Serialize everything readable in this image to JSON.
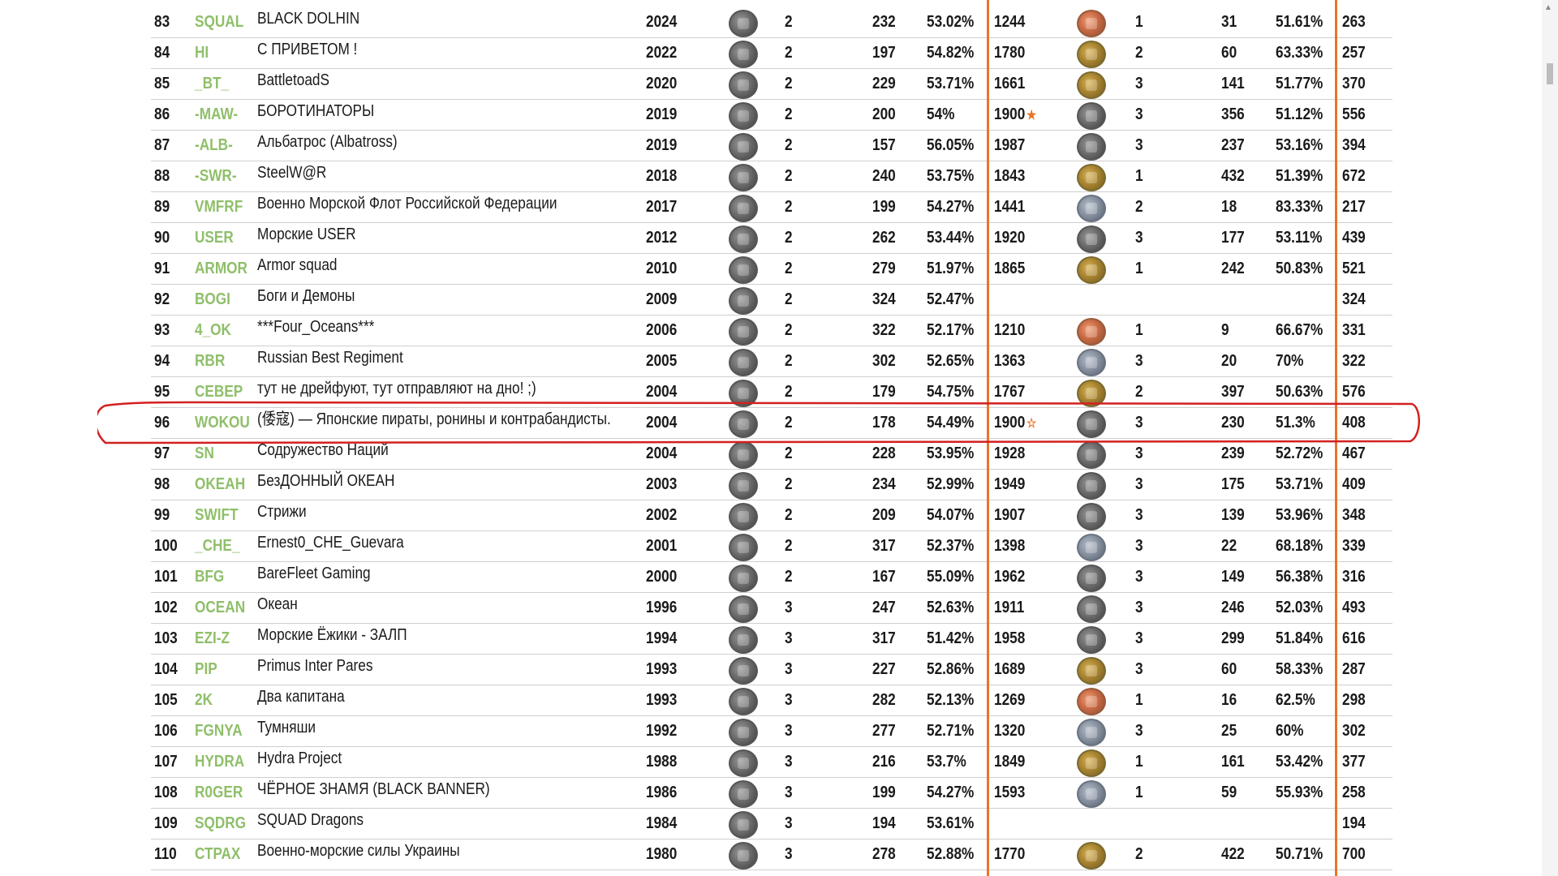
{
  "table": {
    "rows": [
      {
        "rank": "83",
        "tag": "SQUAL",
        "name": "BLACK DOLHIN",
        "year": "2024",
        "m1": "steel",
        "tier": "2",
        "battles": "232",
        "win": "53.02%",
        "rating": "1244",
        "star": "",
        "m2": "bronze",
        "t2": "1",
        "b2": "31",
        "w2": "51.61%",
        "total": "263"
      },
      {
        "rank": "84",
        "tag": "HI",
        "name": "С ПРИВЕТОМ !",
        "year": "2022",
        "m1": "steel",
        "tier": "2",
        "battles": "197",
        "win": "54.82%",
        "rating": "1780",
        "star": "",
        "m2": "gold",
        "t2": "2",
        "b2": "60",
        "w2": "63.33%",
        "total": "257"
      },
      {
        "rank": "85",
        "tag": "_BT_",
        "name": "BattletoadS",
        "year": "2020",
        "m1": "steel",
        "tier": "2",
        "battles": "229",
        "win": "53.71%",
        "rating": "1661",
        "star": "",
        "m2": "gold",
        "t2": "3",
        "b2": "141",
        "w2": "51.77%",
        "total": "370"
      },
      {
        "rank": "86",
        "tag": "-MAW-",
        "name": "БОРОТИНАТОРЫ",
        "year": "2019",
        "m1": "steel",
        "tier": "2",
        "battles": "200",
        "win": "54%",
        "rating": "1900",
        "star": "★",
        "m2": "steel",
        "t2": "3",
        "b2": "356",
        "w2": "51.12%",
        "total": "556"
      },
      {
        "rank": "87",
        "tag": "-ALB-",
        "name": "Альбатрос (Albatross)",
        "year": "2019",
        "m1": "steel",
        "tier": "2",
        "battles": "157",
        "win": "56.05%",
        "rating": "1987",
        "star": "",
        "m2": "steel",
        "t2": "3",
        "b2": "237",
        "w2": "53.16%",
        "total": "394"
      },
      {
        "rank": "88",
        "tag": "-SWR-",
        "name": "SteelW@R",
        "year": "2018",
        "m1": "steel",
        "tier": "2",
        "battles": "240",
        "win": "53.75%",
        "rating": "1843",
        "star": "",
        "m2": "gold",
        "t2": "1",
        "b2": "432",
        "w2": "51.39%",
        "total": "672"
      },
      {
        "rank": "89",
        "tag": "VMFRF",
        "name": "Военно Морской Флот Российской Федерации",
        "year": "2017",
        "m1": "steel",
        "tier": "2",
        "battles": "199",
        "win": "54.27%",
        "rating": "1441",
        "star": "",
        "m2": "silver",
        "t2": "2",
        "b2": "18",
        "w2": "83.33%",
        "total": "217"
      },
      {
        "rank": "90",
        "tag": "USER",
        "name": "Морские USER",
        "year": "2012",
        "m1": "steel",
        "tier": "2",
        "battles": "262",
        "win": "53.44%",
        "rating": "1920",
        "star": "",
        "m2": "steel",
        "t2": "3",
        "b2": "177",
        "w2": "53.11%",
        "total": "439"
      },
      {
        "rank": "91",
        "tag": "ARMOR",
        "name": "Armor squad",
        "year": "2010",
        "m1": "steel",
        "tier": "2",
        "battles": "279",
        "win": "51.97%",
        "rating": "1865",
        "star": "",
        "m2": "gold",
        "t2": "1",
        "b2": "242",
        "w2": "50.83%",
        "total": "521"
      },
      {
        "rank": "92",
        "tag": "BOGI",
        "name": "Боги и Демоны",
        "year": "2009",
        "m1": "steel",
        "tier": "2",
        "battles": "324",
        "win": "52.47%",
        "rating": "",
        "star": "",
        "m2": "",
        "t2": "",
        "b2": "",
        "w2": "",
        "total": "324"
      },
      {
        "rank": "93",
        "tag": "4_OK",
        "name": "***Four_Oceans***",
        "year": "2006",
        "m1": "steel",
        "tier": "2",
        "battles": "322",
        "win": "52.17%",
        "rating": "1210",
        "star": "",
        "m2": "bronze",
        "t2": "1",
        "b2": "9",
        "w2": "66.67%",
        "total": "331"
      },
      {
        "rank": "94",
        "tag": "RBR",
        "name": "Russian Best Regiment",
        "year": "2005",
        "m1": "steel",
        "tier": "2",
        "battles": "302",
        "win": "52.65%",
        "rating": "1363",
        "star": "",
        "m2": "silver",
        "t2": "3",
        "b2": "20",
        "w2": "70%",
        "total": "322"
      },
      {
        "rank": "95",
        "tag": "СЕВЕР",
        "name": "тут не дрейфуют, тут отправляют на дно! ;)",
        "year": "2004",
        "m1": "steel",
        "tier": "2",
        "battles": "179",
        "win": "54.75%",
        "rating": "1767",
        "star": "",
        "m2": "gold",
        "t2": "2",
        "b2": "397",
        "w2": "50.63%",
        "total": "576"
      },
      {
        "rank": "96",
        "tag": "WOKOU",
        "name": "(倭寇) — Японские пираты, ронины и контрабандисты.",
        "year": "2004",
        "m1": "steel",
        "tier": "2",
        "battles": "178",
        "win": "54.49%",
        "rating": "1900",
        "star": "☆",
        "m2": "steel",
        "t2": "3",
        "b2": "230",
        "w2": "51.3%",
        "total": "408"
      },
      {
        "rank": "97",
        "tag": "SN",
        "name": "Содружество Наций",
        "year": "2004",
        "m1": "steel",
        "tier": "2",
        "battles": "228",
        "win": "53.95%",
        "rating": "1928",
        "star": "",
        "m2": "steel",
        "t2": "3",
        "b2": "239",
        "w2": "52.72%",
        "total": "467"
      },
      {
        "rank": "98",
        "tag": "OKEAH",
        "name": "БезДОННЫЙ ОКЕАН",
        "year": "2003",
        "m1": "steel",
        "tier": "2",
        "battles": "234",
        "win": "52.99%",
        "rating": "1949",
        "star": "",
        "m2": "steel",
        "t2": "3",
        "b2": "175",
        "w2": "53.71%",
        "total": "409"
      },
      {
        "rank": "99",
        "tag": "SWIFT",
        "name": "Стрижи",
        "year": "2002",
        "m1": "steel",
        "tier": "2",
        "battles": "209",
        "win": "54.07%",
        "rating": "1907",
        "star": "",
        "m2": "steel",
        "t2": "3",
        "b2": "139",
        "w2": "53.96%",
        "total": "348"
      },
      {
        "rank": "100",
        "tag": "_CHE_",
        "name": "Ernest0_CHE_Guevara",
        "year": "2001",
        "m1": "steel",
        "tier": "2",
        "battles": "317",
        "win": "52.37%",
        "rating": "1398",
        "star": "",
        "m2": "silver",
        "t2": "3",
        "b2": "22",
        "w2": "68.18%",
        "total": "339"
      },
      {
        "rank": "101",
        "tag": "BFG",
        "name": "BareFleet Gaming",
        "year": "2000",
        "m1": "steel",
        "tier": "2",
        "battles": "167",
        "win": "55.09%",
        "rating": "1962",
        "star": "",
        "m2": "steel",
        "t2": "3",
        "b2": "149",
        "w2": "56.38%",
        "total": "316"
      },
      {
        "rank": "102",
        "tag": "OCEAN",
        "name": "Океан",
        "year": "1996",
        "m1": "steel",
        "tier": "3",
        "battles": "247",
        "win": "52.63%",
        "rating": "1911",
        "star": "",
        "m2": "steel",
        "t2": "3",
        "b2": "246",
        "w2": "52.03%",
        "total": "493"
      },
      {
        "rank": "103",
        "tag": "EZI-Z",
        "name": "Морские Ёжики - ЗАЛП",
        "year": "1994",
        "m1": "steel",
        "tier": "3",
        "battles": "317",
        "win": "51.42%",
        "rating": "1958",
        "star": "",
        "m2": "steel",
        "t2": "3",
        "b2": "299",
        "w2": "51.84%",
        "total": "616"
      },
      {
        "rank": "104",
        "tag": "PIP",
        "name": "Primus Inter Pares",
        "year": "1993",
        "m1": "steel",
        "tier": "3",
        "battles": "227",
        "win": "52.86%",
        "rating": "1689",
        "star": "",
        "m2": "gold",
        "t2": "3",
        "b2": "60",
        "w2": "58.33%",
        "total": "287"
      },
      {
        "rank": "105",
        "tag": "2K",
        "name": "Два капитана",
        "year": "1993",
        "m1": "steel",
        "tier": "3",
        "battles": "282",
        "win": "52.13%",
        "rating": "1269",
        "star": "",
        "m2": "bronze",
        "t2": "1",
        "b2": "16",
        "w2": "62.5%",
        "total": "298"
      },
      {
        "rank": "106",
        "tag": "FGNYA",
        "name": "Тумняши",
        "year": "1992",
        "m1": "steel",
        "tier": "3",
        "battles": "277",
        "win": "52.71%",
        "rating": "1320",
        "star": "",
        "m2": "silver",
        "t2": "3",
        "b2": "25",
        "w2": "60%",
        "total": "302"
      },
      {
        "rank": "107",
        "tag": "HYDRA",
        "name": "Hydra Project",
        "year": "1988",
        "m1": "steel",
        "tier": "3",
        "battles": "216",
        "win": "53.7%",
        "rating": "1849",
        "star": "",
        "m2": "gold",
        "t2": "1",
        "b2": "161",
        "w2": "53.42%",
        "total": "377"
      },
      {
        "rank": "108",
        "tag": "R0GER",
        "name": "ЧЁРНОЕ ЗНАМЯ (BLACK BANNER)",
        "year": "1986",
        "m1": "steel",
        "tier": "3",
        "battles": "199",
        "win": "54.27%",
        "rating": "1593",
        "star": "",
        "m2": "silver",
        "t2": "1",
        "b2": "59",
        "w2": "55.93%",
        "total": "258"
      },
      {
        "rank": "109",
        "tag": "SQDRG",
        "name": "SQUAD Dragons",
        "year": "1984",
        "m1": "steel",
        "tier": "3",
        "battles": "194",
        "win": "53.61%",
        "rating": "",
        "star": "",
        "m2": "",
        "t2": "",
        "b2": "",
        "w2": "",
        "total": "194"
      },
      {
        "rank": "110",
        "tag": "СТРАХ",
        "name": "Военно-морские силы Украины",
        "year": "1980",
        "m1": "steel",
        "tier": "3",
        "battles": "278",
        "win": "52.88%",
        "rating": "1770",
        "star": "",
        "m2": "gold",
        "t2": "2",
        "b2": "422",
        "w2": "50.71%",
        "total": "700"
      }
    ]
  },
  "colors": {
    "tag": "#8fbf6a",
    "divider": "#e8742a",
    "highlight": "#d32020"
  },
  "icons": {
    "medal": "medal-icon",
    "star": "star-icon"
  }
}
